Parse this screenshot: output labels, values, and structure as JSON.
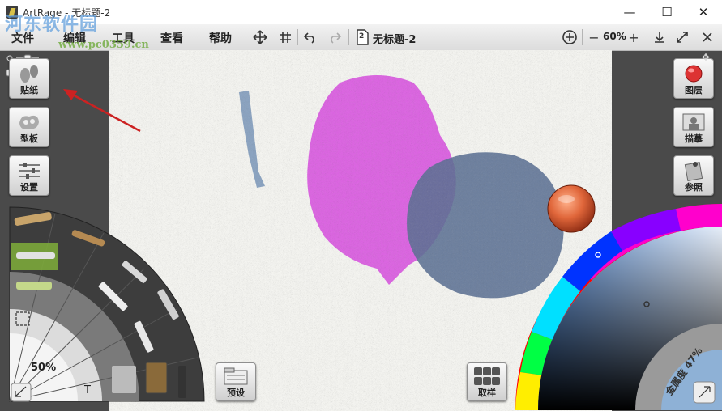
{
  "titlebar": {
    "title": "ArtRage - 无标题-2",
    "minimize": "—",
    "maximize": "☐",
    "close": "✕"
  },
  "watermark": {
    "text": "河东软件园",
    "url": "www.pc0359.cn"
  },
  "menu": {
    "items": [
      "文件",
      "编辑",
      "工具",
      "查看",
      "帮助"
    ],
    "doc_number": "2",
    "doc_name": "无标题-2",
    "zoom_minus": "−",
    "zoom_value": "60%",
    "zoom_plus": "+"
  },
  "left_panel": {
    "stickers_label": "贴纸",
    "stencils_label": "型板",
    "settings_label": "设置"
  },
  "right_panel": {
    "layers_label": "图层",
    "tracing_label": "描摹",
    "reference_label": "参照"
  },
  "bottom": {
    "presets_label": "预设",
    "samples_label": "取样",
    "tool_size": "50%",
    "metallic_label": "金属度 47%",
    "text_tool": "T"
  },
  "colors": {
    "accent_red": "#cc2222",
    "paint_magenta": "#d84ae0",
    "paint_blue": "#5a6f93",
    "stroke_blue": "#7f9bbd",
    "current_color": "#e0663a"
  }
}
